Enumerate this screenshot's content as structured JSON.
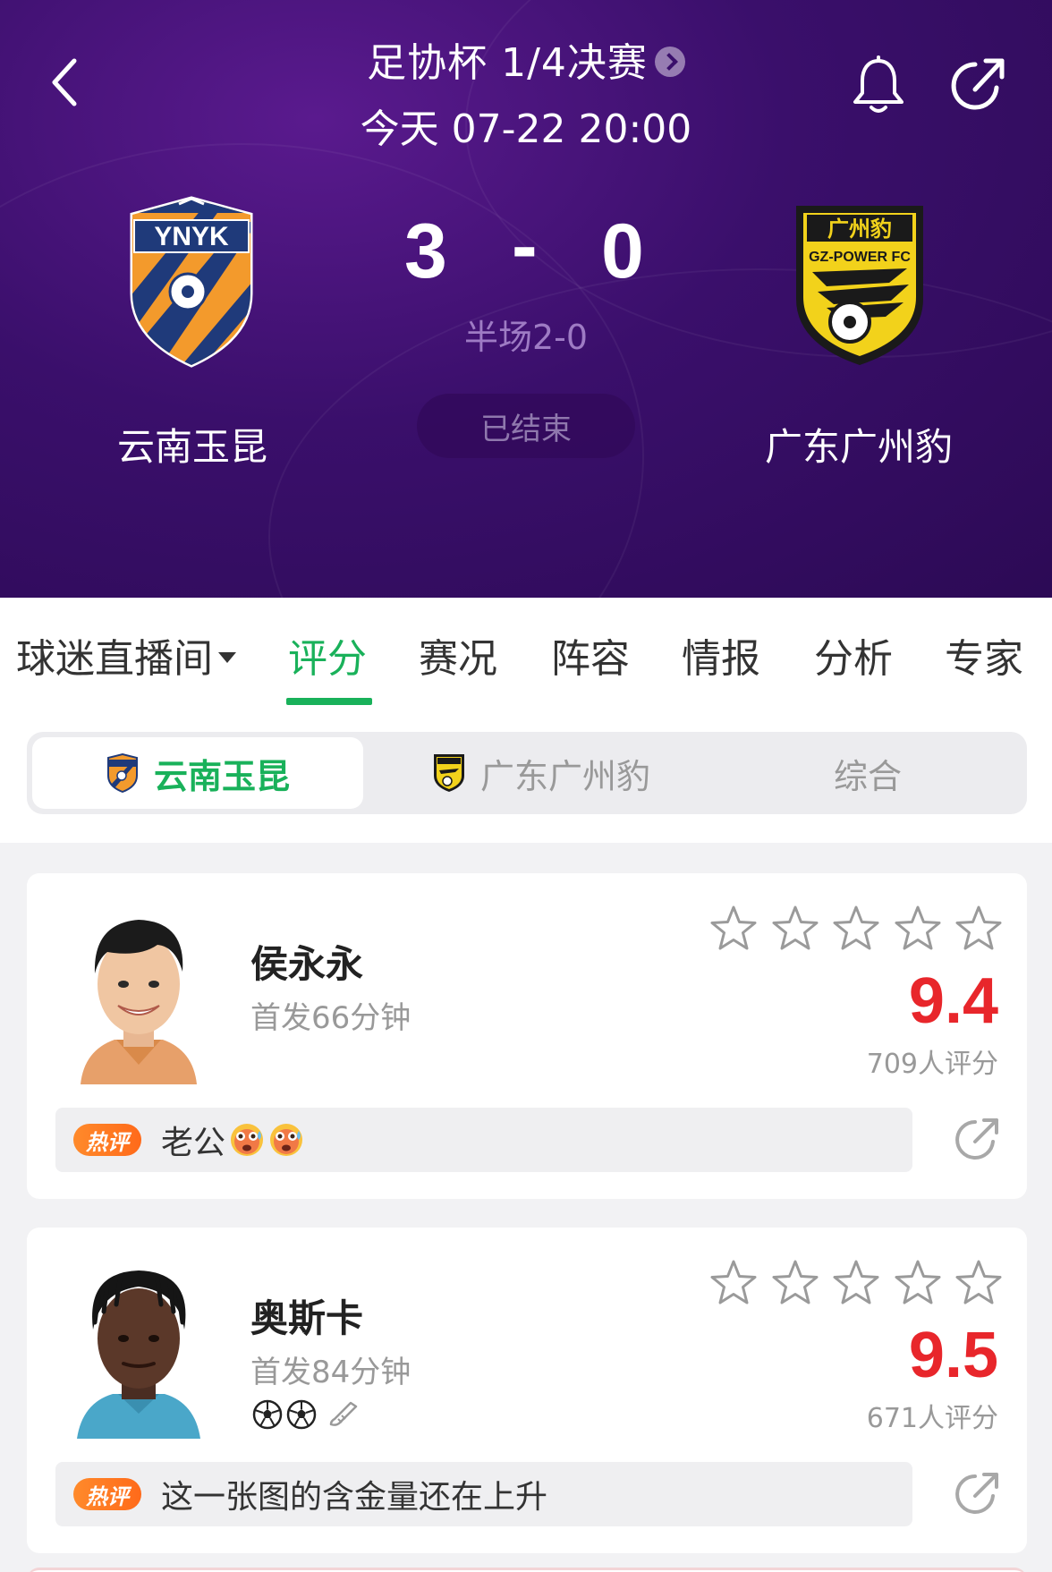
{
  "header": {
    "competition": "足协杯 1/4决赛",
    "match_time": "今天 07-22 20:00",
    "home_team": {
      "name": "云南玉昆",
      "logo_text": "YNYK"
    },
    "away_team": {
      "name": "广东广州豹",
      "logo_text_top": "广州豹",
      "logo_text_mid": "GZ-POWER FC"
    },
    "home_score": "3",
    "score_separator": "-",
    "away_score": "0",
    "half_time": "半场2-0",
    "status": "已结束",
    "icons": {
      "back": "back-chevron-icon",
      "bell": "bell-icon",
      "share": "share-icon"
    },
    "colors": {
      "bg": "#3a0f6b",
      "accent": "#9e7bc4"
    }
  },
  "tabs": {
    "items": [
      {
        "label": "球迷直播间",
        "has_dropdown": true
      },
      {
        "label": "评分",
        "active": true
      },
      {
        "label": "赛况"
      },
      {
        "label": "阵容"
      },
      {
        "label": "情报"
      },
      {
        "label": "分析"
      },
      {
        "label": "专家"
      }
    ],
    "active_color": "#19b15a"
  },
  "segment": {
    "items": [
      {
        "label": "云南玉昆",
        "active": true
      },
      {
        "label": "广东广州豹"
      },
      {
        "label": "综合"
      }
    ]
  },
  "players": [
    {
      "name": "侯永永",
      "subtitle": "首发66分钟",
      "stars_filled": 0,
      "stars_total": 5,
      "rating": "9.4",
      "rating_count": "709人评分",
      "events": [],
      "hot_comment": {
        "badge": "热评",
        "text": "老公",
        "emojis": [
          "flushed-face-icon",
          "flushed-face-icon"
        ]
      }
    },
    {
      "name": "奥斯卡",
      "subtitle": "首发84分钟",
      "stars_filled": 0,
      "stars_total": 5,
      "rating": "9.5",
      "rating_count": "671人评分",
      "events": [
        "goal-icon",
        "goal-icon",
        "assist-boot-icon"
      ],
      "hot_comment": {
        "badge": "热评",
        "text": "这一张图的含金量还在上升",
        "emojis": []
      }
    }
  ],
  "colors": {
    "rating": "#e8262b",
    "hot_badge": "#ff7a22"
  }
}
